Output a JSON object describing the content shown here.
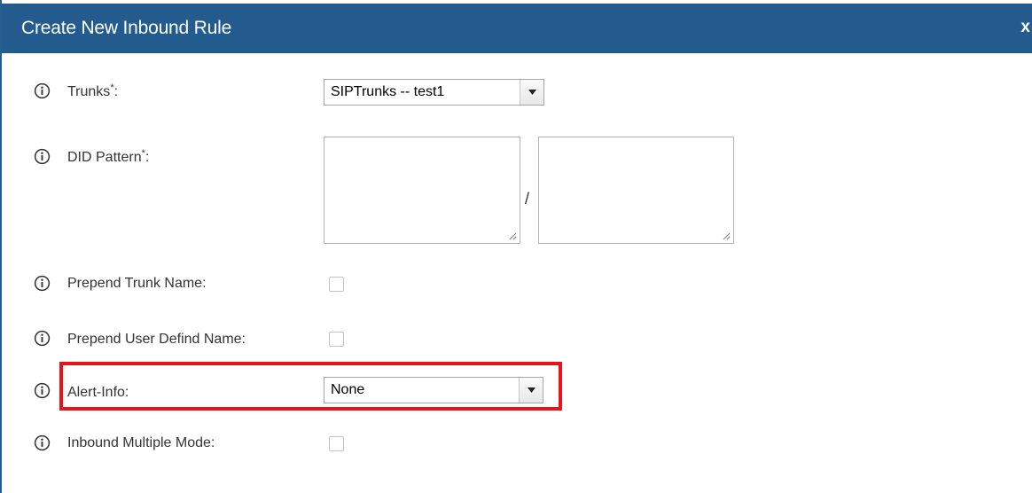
{
  "dialog": {
    "title": "Create New Inbound Rule",
    "close_label": "x"
  },
  "fields": {
    "trunks": {
      "label": "Trunks",
      "required_mark": "*",
      "colon": ":",
      "value": "SIPTrunks -- test1"
    },
    "did_pattern": {
      "label": "DID Pattern",
      "required_mark": "*",
      "colon": ":",
      "separator": "/",
      "value_left": "",
      "value_right": ""
    },
    "prepend_trunk_name": {
      "label": "Prepend Trunk Name:",
      "checked": false
    },
    "prepend_user_defind_name": {
      "label": "Prepend User Defind Name:",
      "checked": false
    },
    "alert_info": {
      "label": "Alert-Info:",
      "value": "None"
    },
    "inbound_multiple_mode": {
      "label": "Inbound Multiple Mode:",
      "checked": false
    }
  },
  "icons": {
    "info": "info-circle-icon",
    "dropdown": "triangle-down-icon",
    "resize": "resize-grip-icon"
  },
  "colors": {
    "titlebar": "#235b8e",
    "highlight": "#e8141b"
  }
}
